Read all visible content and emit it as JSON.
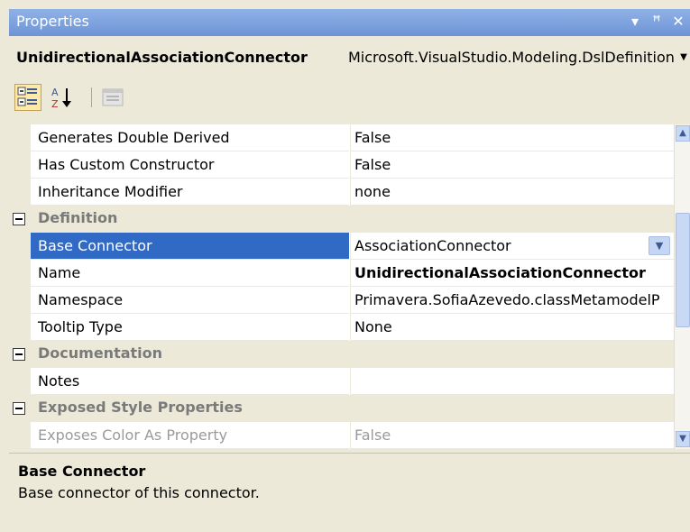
{
  "window": {
    "title": "Properties",
    "buttons": {
      "dropdown": "▾",
      "pin": "ꟸ",
      "close": "✕"
    }
  },
  "object_selector": {
    "name": "UnidirectionalAssociationConnector",
    "type": "Microsoft.VisualStudio.Modeling.DslDefinition"
  },
  "toolbar": {
    "categorized_icon": "categorized-icon",
    "alphabetical_icon": "alphabetical-icon",
    "property_pages_icon": "property-pages-icon"
  },
  "grid": {
    "rows": [
      {
        "kind": "prop",
        "name": "Generates Double Derived",
        "value": "False"
      },
      {
        "kind": "prop",
        "name": "Has Custom Constructor",
        "value": "False"
      },
      {
        "kind": "prop",
        "name": "Inheritance Modifier",
        "value": "none"
      },
      {
        "kind": "cat",
        "name": "Definition"
      },
      {
        "kind": "prop",
        "name": "Base Connector",
        "value": "AssociationConnector",
        "selected": true
      },
      {
        "kind": "prop",
        "name": "Name",
        "value": "UnidirectionalAssociationConnector",
        "bold": true
      },
      {
        "kind": "prop",
        "name": "Namespace",
        "value": "Primavera.SofiaAzevedo.classMetamodelP"
      },
      {
        "kind": "prop",
        "name": "Tooltip Type",
        "value": "None"
      },
      {
        "kind": "cat",
        "name": "Documentation"
      },
      {
        "kind": "prop",
        "name": "Notes",
        "value": ""
      },
      {
        "kind": "cat",
        "name": "Exposed Style Properties"
      },
      {
        "kind": "prop",
        "name": "Exposes Color As Property",
        "value": "False",
        "disabled": true
      }
    ]
  },
  "description": {
    "title": "Base Connector",
    "text": "Base connector of this connector."
  },
  "colors": {
    "selection": "#316ac5",
    "titlebar": "#7a9edd",
    "panel": "#ece9d8"
  }
}
